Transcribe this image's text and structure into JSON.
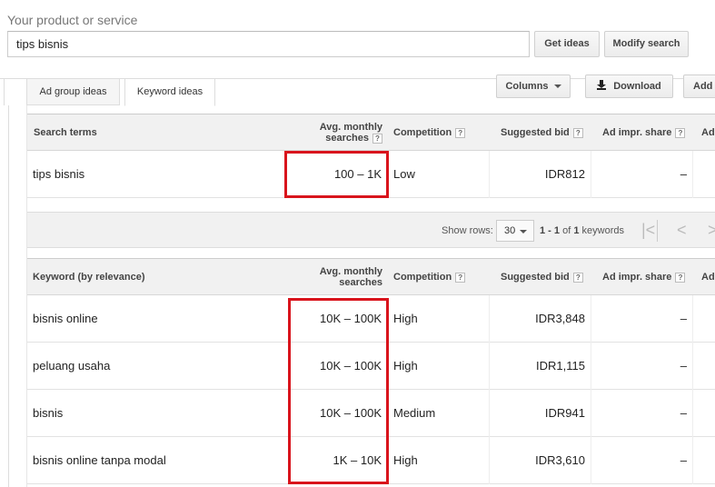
{
  "search": {
    "label": "Your product or service",
    "value": "tips bisnis",
    "get_ideas": "Get ideas",
    "modify_search": "Modify search"
  },
  "tabs": [
    {
      "label": "Ad group ideas",
      "active": false
    },
    {
      "label": "Keyword ideas",
      "active": true
    }
  ],
  "toolbar": {
    "columns": "Columns",
    "download": "Download",
    "add": "Add"
  },
  "columns": {
    "search_terms": "Search terms",
    "keyword_relevance": "Keyword (by relevance)",
    "avg_line1": "Avg. monthly",
    "avg_line2": "searches",
    "competition": "Competition",
    "suggested_bid": "Suggested bid",
    "ad_impr_share": "Ad impr. share",
    "add_short": "Ad",
    "help": "?"
  },
  "search_terms_rows": [
    {
      "keyword": "tips bisnis",
      "avg": "100 – 1K",
      "competition": "Low",
      "bid": "IDR812",
      "impr": "–"
    }
  ],
  "pager": {
    "show_rows_label": "Show rows:",
    "rows_value": "30",
    "range": "1 - 1",
    "of_label": "of",
    "total": "1",
    "unit": "keywords"
  },
  "keyword_rows": [
    {
      "keyword": "bisnis online",
      "avg": "10K – 100K",
      "competition": "High",
      "bid": "IDR3,848",
      "impr": "–"
    },
    {
      "keyword": "peluang usaha",
      "avg": "10K – 100K",
      "competition": "High",
      "bid": "IDR1,115",
      "impr": "–"
    },
    {
      "keyword": "bisnis",
      "avg": "10K – 100K",
      "competition": "Medium",
      "bid": "IDR941",
      "impr": "–"
    },
    {
      "keyword": "bisnis online tanpa modal",
      "avg": "1K – 10K",
      "competition": "High",
      "bid": "IDR3,610",
      "impr": "–"
    }
  ],
  "icons": {
    "first_page": "|<",
    "prev_page": "<",
    "next_page": ">"
  },
  "colors": {
    "highlight": "#d9141c"
  }
}
